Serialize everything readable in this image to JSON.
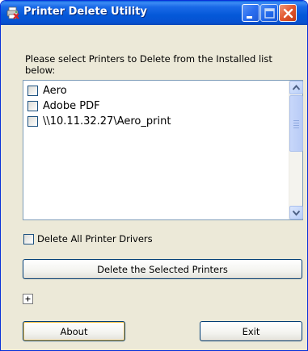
{
  "window": {
    "title": "Printer Delete Utility",
    "icon": "printer-delete-icon",
    "controls": [
      "minimize-icon",
      "maximize-icon",
      "close-icon"
    ],
    "accent_color": "#0458d8",
    "close_color": "#e2572e"
  },
  "prompt": {
    "text": "Please select Printers to Delete from the Installed list below:"
  },
  "printers": {
    "items": [
      {
        "label": "Aero",
        "checked": false
      },
      {
        "label": "Adobe PDF",
        "checked": false
      },
      {
        "label": "\\\\10.11.32.27\\Aero_print",
        "checked": false
      }
    ]
  },
  "options": {
    "delete_drivers_label": "Delete All Printer Drivers",
    "delete_drivers_checked": false
  },
  "actions": {
    "delete_selected_label": "Delete the Selected Printers",
    "expand_glyph": "+",
    "about_label": "About",
    "exit_label": "Exit"
  }
}
